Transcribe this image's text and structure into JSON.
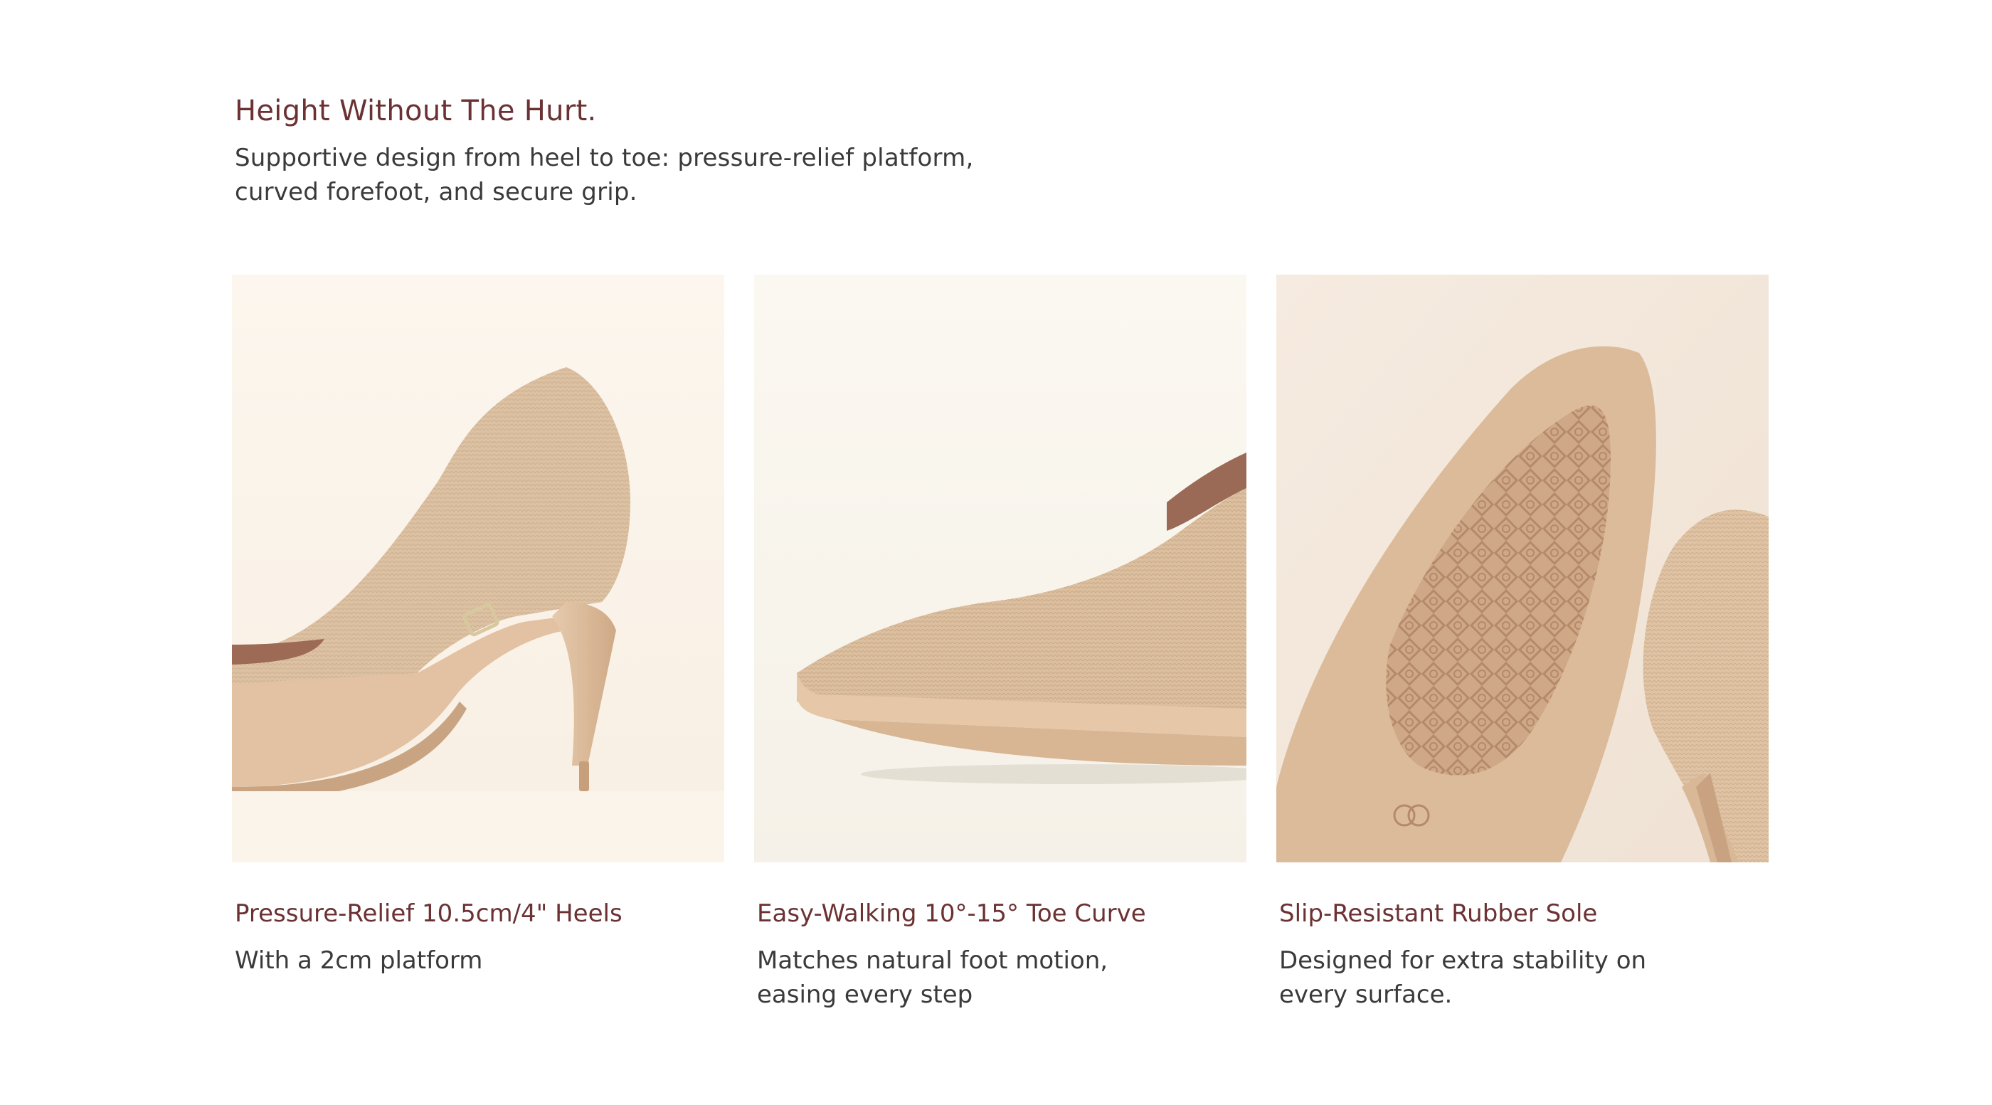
{
  "header": {
    "title": "Height Without The Hurt.",
    "subtitle": "Supportive design from heel to toe: pressure-relief platform, curved forefoot, and secure grip."
  },
  "features": [
    {
      "title": "Pressure-Relief 10.5cm/4\" Heels",
      "description": "With a 2cm platform",
      "image": "shoe-heel-side-view"
    },
    {
      "title": "Easy-Walking 10°-15° Toe Curve",
      "description": "Matches natural foot motion, easing every step",
      "image": "shoe-toe-curve-view"
    },
    {
      "title": "Slip-Resistant Rubber Sole",
      "description": "Designed for extra stability on every surface.",
      "image": "shoe-sole-tread-view"
    }
  ],
  "colors": {
    "accent": "#6b3133",
    "body_text": "#3a3a3a",
    "shoe": "#ddbf9f",
    "image_background": "#fbf5ec"
  }
}
